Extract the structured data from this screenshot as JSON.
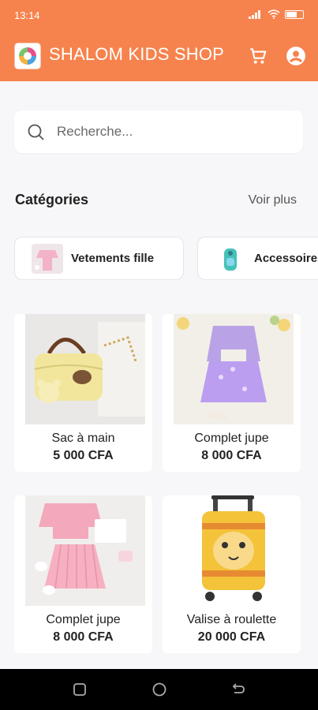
{
  "status_bar": {
    "time": "13:14"
  },
  "app": {
    "title": "SHALOM KIDS SHOP",
    "accent": "#f6834d"
  },
  "search": {
    "placeholder": "Recherche..."
  },
  "categories": {
    "heading": "Catégories",
    "see_more": "Voir plus",
    "items": [
      {
        "label": "Vetements fille"
      },
      {
        "label": "Accessoires"
      }
    ]
  },
  "products": [
    {
      "name": "Sac à main",
      "price": "5 000 CFA"
    },
    {
      "name": "Complet jupe",
      "price": "8 000 CFA"
    },
    {
      "name": "Complet jupe",
      "price": "8 000 CFA"
    },
    {
      "name": "Valise à roulette",
      "price": "20 000 CFA"
    }
  ]
}
